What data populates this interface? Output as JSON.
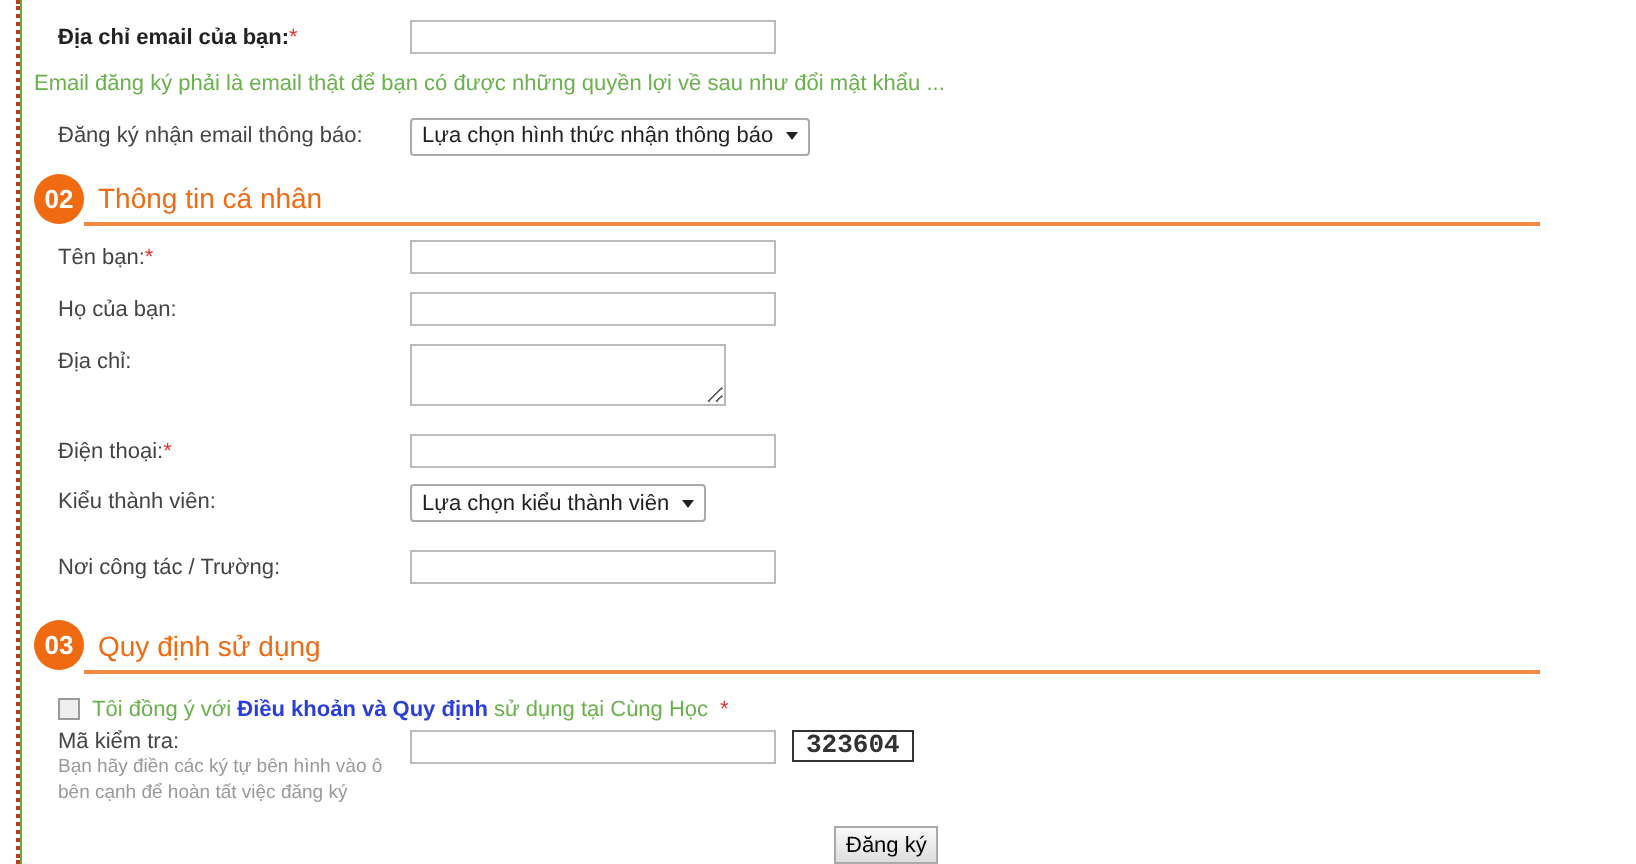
{
  "account": {
    "rows": [
      {
        "label": "Địa chỉ email của bạn:",
        "mark": "*",
        "bold": true,
        "field": {
          "kind": "text"
        }
      }
    ],
    "note": "Email đăng ký phải là email thật để bạn có được những quyền lợi về sau như đổi mật khẩu ...",
    "notify": {
      "label": "Đăng ký nhận email thông báo:",
      "field": {
        "kind": "select",
        "value": "Lựa chọn hình thức nhận thông báo"
      }
    }
  },
  "sections": [
    {
      "number": "02",
      "title": "Thông tin cá nhân",
      "rows": [
        {
          "label": "Tên bạn:",
          "mark": "*",
          "field": {
            "kind": "text"
          }
        },
        {
          "label": "Họ của bạn:",
          "field": {
            "kind": "text"
          }
        },
        {
          "label": "Địa chỉ:",
          "field": {
            "kind": "textarea"
          }
        },
        {
          "label": "Điện thoại:",
          "mark": "*",
          "field": {
            "kind": "text"
          }
        },
        {
          "label": "Kiểu thành viên:",
          "field": {
            "kind": "select",
            "value": "Lựa chọn kiểu thành viên"
          }
        },
        {
          "label": "Nơi công tác / Trường:",
          "field": {
            "kind": "text"
          }
        }
      ]
    },
    {
      "number": "03",
      "title": "Quy định sử dụng"
    }
  ],
  "terms": {
    "checked": false,
    "before": "Tôi đồng ý với",
    "link": "Điều khoản và Quy định",
    "after": "sử dụng tại Cùng Học",
    "mark": "*"
  },
  "captcha": {
    "label": "Mã kiểm tra:",
    "hint": "Bạn hãy điền các ký tự bên hình vào ô bên cạnh để hoàn tất việc đăng ký",
    "code": "323604"
  },
  "submit": "Đăng ký"
}
